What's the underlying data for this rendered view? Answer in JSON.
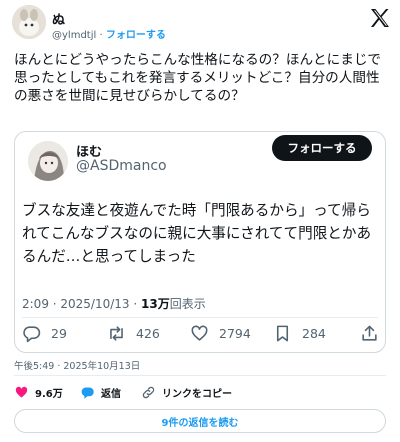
{
  "author": {
    "name": "ぬ",
    "handle": "@ylmdtjl",
    "separator": "·",
    "follow_label": "フォローする"
  },
  "tweet": {
    "text": "ほんとにどうやったらこんな性格になるの？ほんとにまじで\n思ったとしてもこれを発言するメリットどこ？自分の人間性の悪さを世間に見せびらかしてるの？"
  },
  "quote": {
    "name": "ほむ",
    "handle": "@ASDmanco",
    "follow_label": "フォローする",
    "text": "ブスな友達と夜遊んでた時「門限あるから」って帰られてこんなブスなのに親に大事にされてて門限とかあるんだ…と思ってしまった",
    "time": "2:09 · 2025/10/13 · ",
    "views_count": "13万",
    "views_label": "回表示",
    "actions": {
      "replies": "29",
      "reposts": "426",
      "likes": "2794",
      "bookmarks": "284"
    }
  },
  "timestamp": "午後5:49 · 2025年10月13日",
  "bottom": {
    "likes": "9.6万",
    "reply_label": "返信",
    "copy_link_label": "リンクをコピー"
  },
  "read_replies_label": "9件の返信を読む",
  "colors": {
    "accent": "#1d9bf0",
    "like": "#f91880",
    "text": "#0f1419",
    "muted": "#536471",
    "border": "#cfd9de"
  }
}
